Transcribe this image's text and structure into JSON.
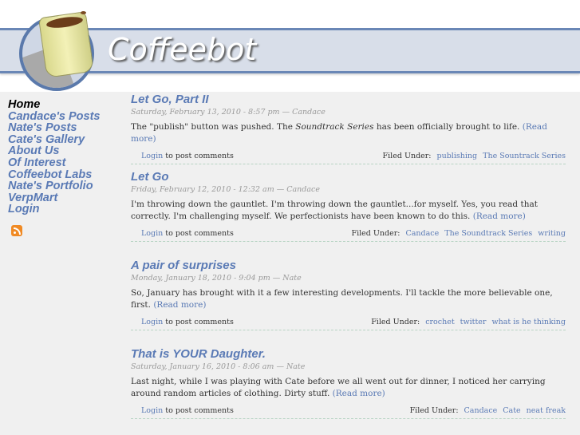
{
  "site": {
    "title": "Coffeebot",
    "logo": "coffee-cup-robot-logo"
  },
  "sidebar": {
    "items": [
      {
        "label": "Home",
        "current": true
      },
      {
        "label": "Candace's Posts"
      },
      {
        "label": "Nate's Posts"
      },
      {
        "label": "Cate's Gallery"
      },
      {
        "label": "About Us"
      },
      {
        "label": "Of Interest"
      },
      {
        "label": "Coffeebot Labs"
      },
      {
        "label": "Nate's Portfolio"
      },
      {
        "label": "VerpMart"
      },
      {
        "label": "Login"
      }
    ],
    "feed_icon": "rss-icon"
  },
  "posts": [
    {
      "title": "Let Go, Part II",
      "meta": "Saturday, February 13, 2010 - 8:57 pm — Candace",
      "body_pre": "The \"publish\" button was pushed.  The ",
      "body_em": "Soundtrack Series",
      "body_post": " has been officially brought to life.  ",
      "read_more": "(Read more)",
      "login": "Login",
      "login_suffix": " to post comments",
      "filed_under": "Filed Under:",
      "tags": [
        "publishing",
        "The Sountrack Series"
      ]
    },
    {
      "title": "Let Go",
      "meta": "Friday, February 12, 2010 - 12:32 am — Candace",
      "body_pre": "I'm throwing down the gauntlet. I'm throwing down the gauntlet...for myself. Yes, you read that correctly. I'm challenging myself. We perfectionists have been known to do this.  ",
      "read_more": "(Read more)",
      "login": "Login",
      "login_suffix": " to post comments",
      "filed_under": "Filed Under:",
      "tags": [
        "Candace",
        "The Soundtrack Series",
        "writing"
      ]
    },
    {
      "title": "A pair of surprises",
      "meta": "Monday, January 18, 2010 - 9:04 pm — Nate",
      "body_pre": "So, January has brought with it a few interesting developments. I'll tackle the more believable one, first.  ",
      "read_more": "(Read more)",
      "login": "Login",
      "login_suffix": " to post comments",
      "filed_under": "Filed Under:",
      "tags": [
        "crochet",
        "twitter",
        "what is he thinking"
      ]
    },
    {
      "title": "That is YOUR Daughter.",
      "meta": "Saturday, January 16, 2010 - 8:06 am — Nate",
      "body_pre": "Last night, while I was playing with Cate before we all went out for dinner, I noticed her carrying around random articles of clothing. Dirty stuff.  ",
      "read_more": "(Read more)",
      "login": "Login",
      "login_suffix": " to post comments",
      "filed_under": "Filed Under:",
      "tags": [
        "Candace",
        "Cate",
        "neat freak"
      ]
    }
  ],
  "colors": {
    "link": "#5a7ab5",
    "band": "#d8dee9",
    "band_border": "#6a87b6",
    "background": "#f0f0f0"
  }
}
